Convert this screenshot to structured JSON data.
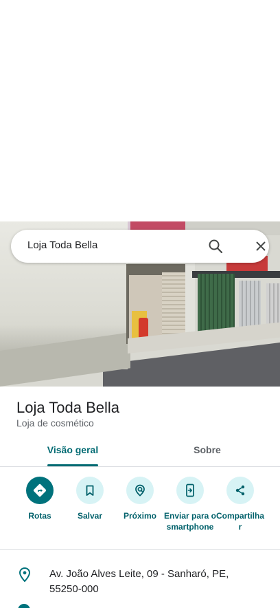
{
  "search": {
    "query": "Loja Toda Bella"
  },
  "place": {
    "name": "Loja Toda Bella",
    "category": "Loja de cosmético"
  },
  "tabs": [
    {
      "label": "Visão geral",
      "active": true
    },
    {
      "label": "Sobre",
      "active": false
    }
  ],
  "actions": [
    {
      "label": "Rotas",
      "icon": "directions-icon"
    },
    {
      "label": "Salvar",
      "icon": "bookmark-icon"
    },
    {
      "label": "Próximo",
      "icon": "nearby-icon"
    },
    {
      "label": "Enviar para o smartphone",
      "icon": "send-to-phone-icon"
    },
    {
      "label": "Compartilhar",
      "icon": "share-icon"
    }
  ],
  "details": {
    "address": "Av. João Alves Leite, 09 - Sanharó, PE, 55250-000"
  },
  "colors": {
    "accent": "#006a72",
    "action_bg": "#d7f3f5",
    "action_primary": "#00727c"
  }
}
